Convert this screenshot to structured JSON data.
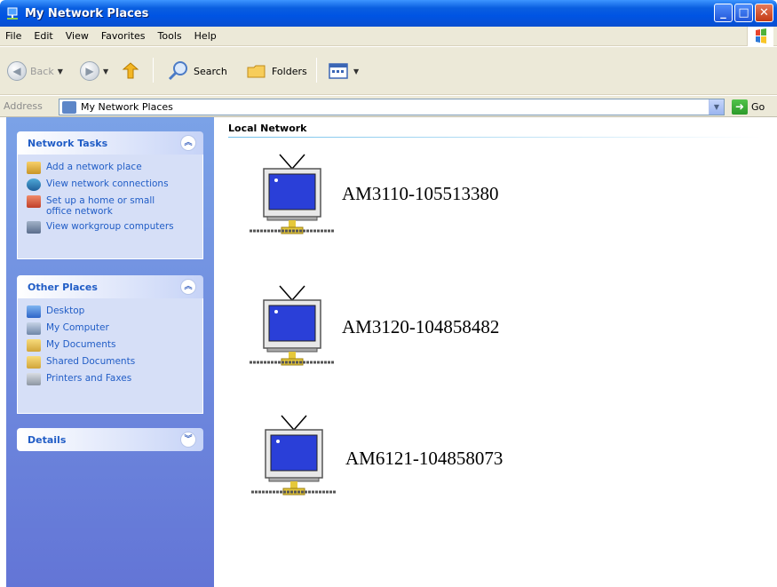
{
  "window": {
    "title": "My Network Places",
    "controls": [
      "minimize-icon",
      "maximize-icon",
      "close-icon"
    ]
  },
  "menu": [
    "File",
    "Edit",
    "View",
    "Favorites",
    "Tools",
    "Help"
  ],
  "toolbar": {
    "back_label": "Back",
    "search_label": "Search",
    "folders_label": "Folders"
  },
  "address": {
    "label": "Address",
    "value": "My Network Places",
    "go_label": "Go"
  },
  "sidebar": {
    "network_tasks": {
      "title": "Network Tasks",
      "items": [
        {
          "label": "Add a network place",
          "icon": "add-network-place-icon"
        },
        {
          "label": "View network connections",
          "icon": "network-connections-icon"
        },
        {
          "label": "Set up a home or small office network",
          "icon": "home-network-icon"
        },
        {
          "label": "View workgroup computers",
          "icon": "workgroup-icon"
        }
      ]
    },
    "other_places": {
      "title": "Other Places",
      "items": [
        {
          "label": "Desktop",
          "icon": "desktop-icon"
        },
        {
          "label": "My Computer",
          "icon": "my-computer-icon"
        },
        {
          "label": "My Documents",
          "icon": "my-documents-icon"
        },
        {
          "label": "Shared Documents",
          "icon": "shared-folder-icon"
        },
        {
          "label": "Printers and Faxes",
          "icon": "printer-icon"
        }
      ]
    },
    "details": {
      "title": "Details"
    }
  },
  "main": {
    "group_title": "Local Network",
    "devices": [
      {
        "label": "AM3110-105513380",
        "icon": "network-device-icon"
      },
      {
        "label": "AM3120-104858482",
        "icon": "network-device-icon"
      },
      {
        "label": "AM6121-104858073",
        "icon": "network-device-icon"
      }
    ]
  },
  "colors": {
    "titlebar": "#0054e3",
    "sidebar_top": "#7ba2e7",
    "sidebar_bottom": "#6375d6",
    "task_link": "#215dc6",
    "screen_blue": "#1f3fd6"
  }
}
